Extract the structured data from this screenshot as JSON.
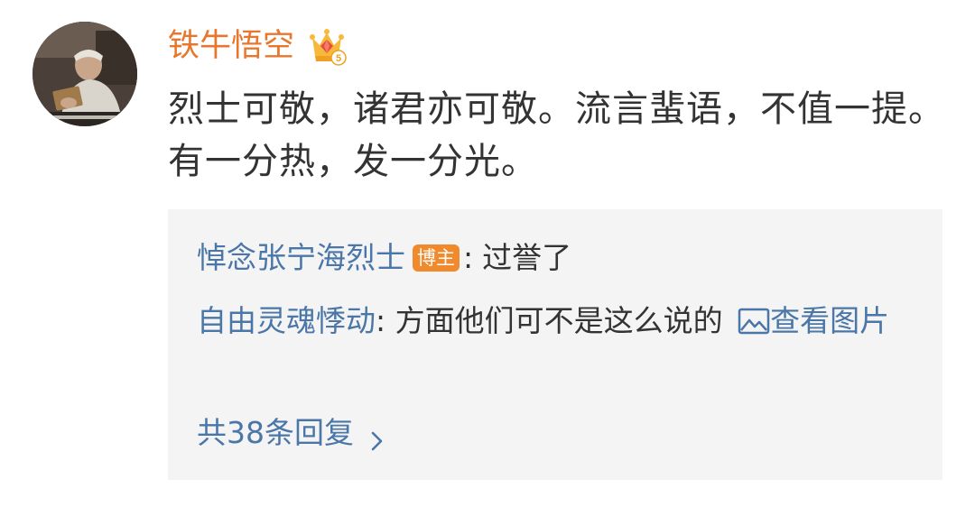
{
  "post": {
    "username": "铁牛悟空",
    "vip_level": "5",
    "text": "烈士可敬，诸君亦可敬。流言蜚语，不值一提。有一分热，发一分光。"
  },
  "comments": [
    {
      "author": "悼念张宁海烈士",
      "badge": "博主",
      "separator": ":",
      "text": "过誉了"
    },
    {
      "author": "自由灵魂悸动",
      "separator": ":",
      "text": "方面他们可不是这么说的",
      "link_label": "查看图片"
    }
  ],
  "replies": {
    "label": "共38条回复"
  },
  "colors": {
    "username": "#e8772e",
    "link": "#4a76a8",
    "badge": "#f08a2c",
    "comment_bg": "#f4f4f4"
  },
  "icons": {
    "vip": "crown-gem-icon",
    "image": "image-icon",
    "chevron": "chevron-right-icon"
  }
}
